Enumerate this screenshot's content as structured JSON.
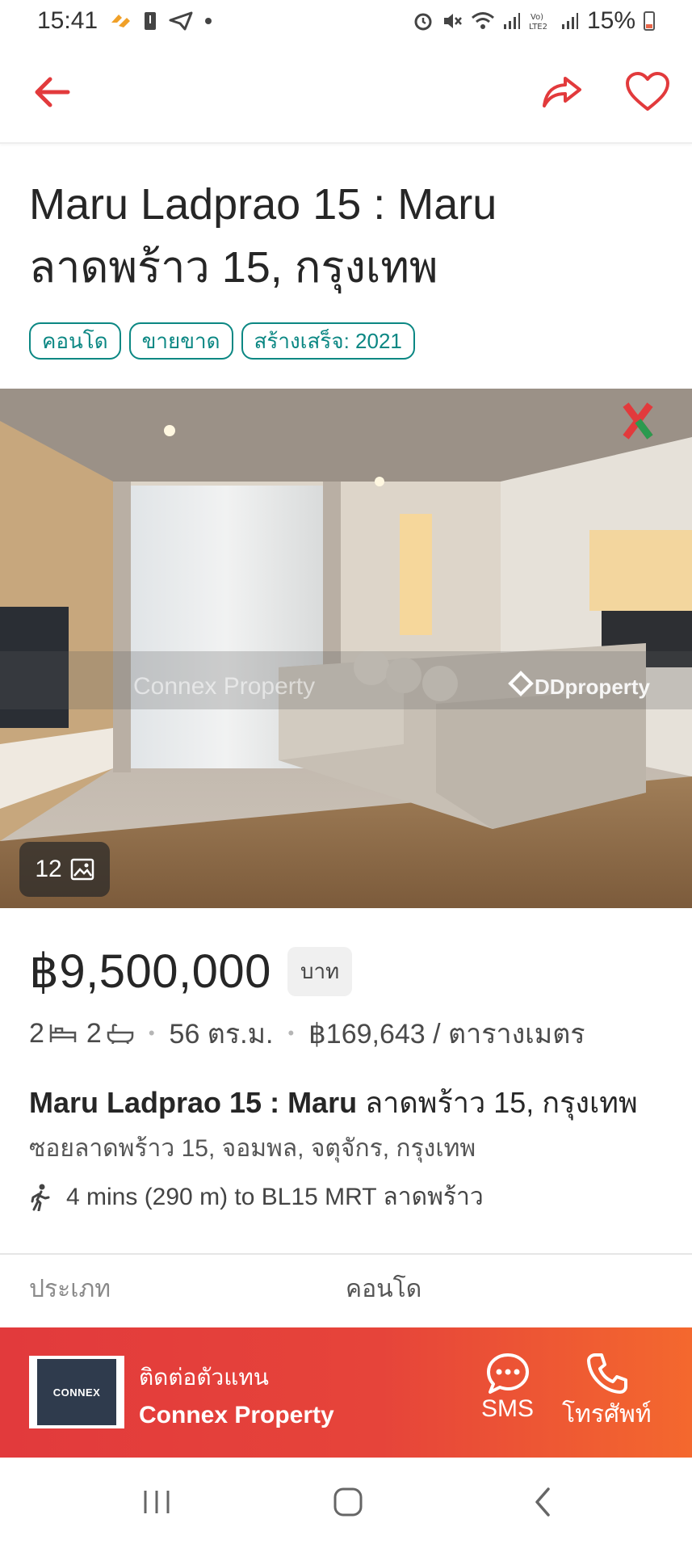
{
  "status_bar": {
    "time": "15:41",
    "battery_percent": "15%"
  },
  "listing": {
    "title": "Maru Ladprao 15 : Maru ลาดพร้าว 15, กรุงเทพ",
    "tags": [
      "คอนโด",
      "ขายขาด",
      "สร้างเสร็จ: 2021"
    ],
    "photo_count": "12",
    "watermark_left": "Connex Property",
    "watermark_right": "DDproperty",
    "price": "฿9,500,000",
    "currency": "บาท",
    "bedrooms": "2",
    "bathrooms": "2",
    "area": "56 ตร.ม.",
    "price_per_area": "฿169,643 / ตารางเมตร",
    "name_bold": "Maru Ladprao 15 : Maru",
    "name_rest": " ลาดพร้าว 15, กรุงเทพ",
    "address": "ซอยลาดพร้าว 15, จอมพล, จตุจักร, กรุงเทพ",
    "transit": "4 mins (290 m) to BL15 MRT ลาดพร้าว"
  },
  "details": {
    "type_label": "ประเภท",
    "type_value": "คอนโด"
  },
  "contact": {
    "label": "ติดต่อตัวแทน",
    "agent_name": "Connex Property",
    "logo_text": "CONNEX",
    "sms_label": "SMS",
    "call_label": "โทรศัพท์"
  },
  "colors": {
    "accent_red": "#e23a3c",
    "tag_teal": "#0b8783",
    "contact_gradient_end": "#f4682e"
  },
  "icons": [
    "back-arrow-icon",
    "share-icon",
    "heart-icon",
    "gallery-icon",
    "bed-icon",
    "bath-icon",
    "walking-icon",
    "chat-icon",
    "phone-icon"
  ]
}
